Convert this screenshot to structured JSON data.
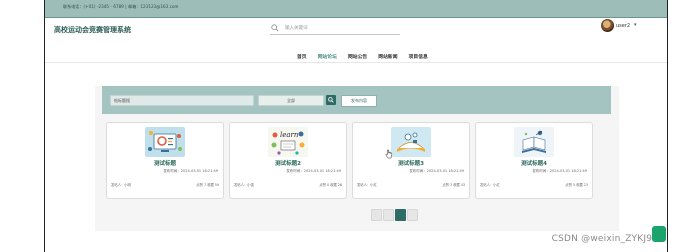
{
  "topbar": {
    "info": "联系电话：(+01) -2345 - 6789 | 邮箱：123123@163.com"
  },
  "header": {
    "site_title": "高校运动会竞赛管理系统",
    "search_placeholder": "输入关键词",
    "username": "user2",
    "caret": "▾"
  },
  "nav": {
    "items": [
      "首页",
      "网站论坛",
      "网站公告",
      "网站新闻",
      "项目信息"
    ],
    "active_index": 1
  },
  "filter": {
    "input_text": "帖标题搜",
    "select_value": "全部",
    "publish_button": "发布内容"
  },
  "cards": [
    {
      "title": "测试标题",
      "time_label": "发布时间：2024-03-01 18:21:49",
      "author": "发帖人：小明",
      "stats": "点赞 7  收藏 59"
    },
    {
      "title": "测试标题2",
      "time_label": "发布时间：2024-03-01 18:21:49",
      "author": "发帖人：小强",
      "stats": "点赞 0  收藏 26"
    },
    {
      "title": "测试标题3",
      "time_label": "发布时间：2024-03-01 18:21:49",
      "author": "发帖人：小红",
      "stats": "点赞 3  收藏 43"
    },
    {
      "title": "测试标题4",
      "time_label": "发布时间：2024-03-01 18:21:49",
      "author": "发帖人：小红",
      "stats": "点赞 5  收藏 23"
    }
  ],
  "pagination": {
    "pages": [
      "",
      "1",
      "2",
      ""
    ],
    "active_index": 2
  },
  "watermark": "CSDN @weixin_ZYKJ985",
  "colors": {
    "accent": "#2f6b65",
    "topbar": "#9dbdb8",
    "filter_bar": "#a3c4c0",
    "title_green": "#2e6b5f"
  },
  "icons": [
    "search-icon",
    "avatar",
    "caret-down-icon",
    "search-button-icon",
    "cursor-icon",
    "corner-badge-icon"
  ]
}
